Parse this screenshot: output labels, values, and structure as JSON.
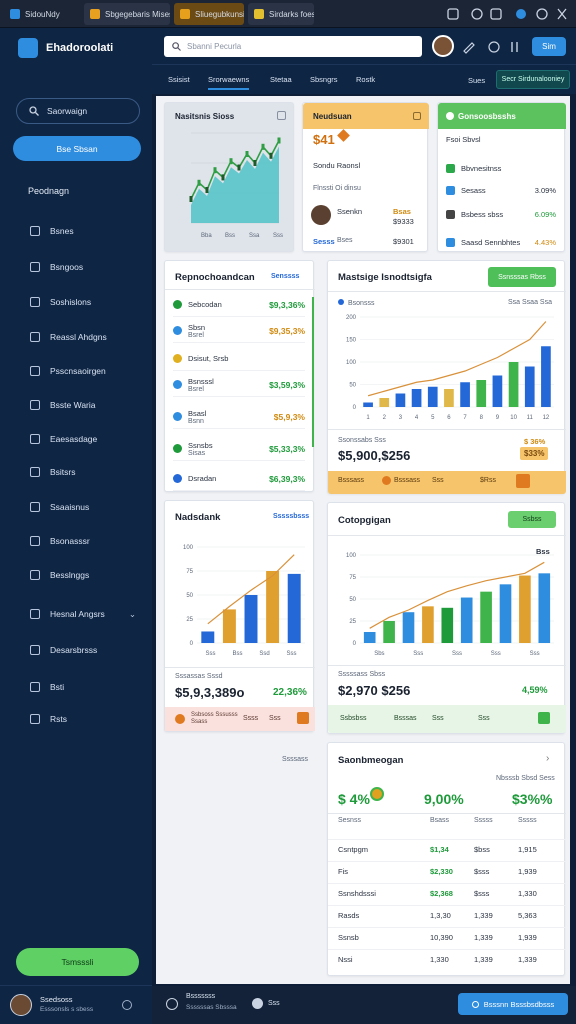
{
  "tabs": [
    {
      "label": "SidouNdy",
      "color": "#2f8de0"
    },
    {
      "label": "Sbgegebaris Mises",
      "color": "#e8a020"
    },
    {
      "label": "Sliuegubkunsi",
      "color": "#e6a01c"
    },
    {
      "label": "Sirdarks foes",
      "color": "#e2c030"
    }
  ],
  "app": {
    "title": "Ehadoroolati"
  },
  "search": {
    "placeholder": "Sbanni Pecurla"
  },
  "topbar": {
    "action_label": "Sim"
  },
  "subnav": {
    "items": [
      "Ssisist",
      "Srorwaewns",
      "Stetaa",
      "Sbsngrs",
      "Rostk"
    ],
    "right_link": "Sues",
    "right_button": "Secr Sirdunalooniey"
  },
  "sidebar": {
    "search_label": "Saorwaign",
    "primary_button": "Bse Sbsan",
    "section_label": "Peodnagn",
    "items": [
      {
        "label": "Bsnes",
        "icon": "book-icon"
      },
      {
        "label": "Bsngoos",
        "icon": "box-icon"
      },
      {
        "label": "Soshislons",
        "icon": "chain-icon"
      },
      {
        "label": "Reassl Ahdgns",
        "icon": "doc-icon"
      },
      {
        "label": "Psscnsaoirgen",
        "icon": "clock-icon"
      },
      {
        "label": "Bsste Waria",
        "icon": "globe-icon"
      },
      {
        "label": "Eaesasdage",
        "icon": "calendar-icon"
      },
      {
        "label": "Bsitsrs",
        "icon": "grid-icon"
      },
      {
        "label": "Ssaaisnus",
        "icon": "chart-icon"
      },
      {
        "label": "Bsonasssr",
        "icon": "layers-icon"
      },
      {
        "label": "Besslnggs",
        "icon": "pen-icon"
      },
      {
        "label": "Hesnal Angsrs",
        "icon": "cog-icon"
      },
      {
        "label": "Desarsbrsss",
        "icon": "filter-icon"
      },
      {
        "label": "Bsti",
        "icon": "gear-icon"
      },
      {
        "label": "Rsts",
        "icon": "refresh-icon"
      }
    ],
    "bottom_button": "Tsmsssli",
    "user_name": "Ssedsoss",
    "user_sub": "Esssonsls s sbess"
  },
  "card1": {
    "title": "Nasitsnis Sioss"
  },
  "card2": {
    "title": "Neudsuan",
    "value": "$41",
    "line1": "Sondu Raonsl",
    "line2": "Flnssti Oi dinsu",
    "rows": [
      {
        "name": "Ssenkn",
        "v1": "Bsas",
        "v2": "$9333"
      },
      {
        "name": "Sesss",
        "v1": "Bses",
        "v2": "$9301"
      }
    ]
  },
  "card3": {
    "title": "Gonsoosbsshs",
    "subtitle": "Fsoi Sbvsl",
    "rows": [
      {
        "name": "Bbvnesitnss",
        "val": "",
        "color": "#2aa84a"
      },
      {
        "name": "Sesass",
        "val": "3.09%",
        "color": "#2f8de0"
      },
      {
        "name": "Bsbess sbss",
        "val": "6.09%",
        "color": "#444444"
      },
      {
        "name": "Saasd Sennbhtes",
        "val": "4.43%",
        "color": "#2f8de0"
      }
    ]
  },
  "card4": {
    "title": "Repnochoandcan",
    "link": "Senssss",
    "rows": [
      {
        "name": "Sebcodan",
        "sub": "",
        "val": "$9,3,36%",
        "vcolor": "#1e9a3a",
        "icolor": "#1e9a3a"
      },
      {
        "name": "Sbsn",
        "sub": "Bsrel",
        "val": "$9,35,3%",
        "vcolor": "#d08a10",
        "icolor": "#2f8de0"
      },
      {
        "name": "Dsisut, Srsb",
        "sub": "",
        "val": "",
        "vcolor": "#1e9a3a",
        "icolor": "#e0b020"
      },
      {
        "name": "Bsnsssl",
        "sub": "Bsrel",
        "val": "$3,59,3%",
        "vcolor": "#1e9a3a",
        "icolor": "#2f8de0"
      },
      {
        "name": "Bsasl",
        "sub": "Bsnn",
        "val": "$5,9,3%",
        "vcolor": "#d08a10",
        "icolor": "#2f8de0"
      },
      {
        "name": "Ssnsbs",
        "sub": "Sisas",
        "val": "$5,33,3%",
        "vcolor": "#1e9a3a",
        "icolor": "#1e9a3a"
      },
      {
        "name": "Dsradan",
        "sub": "",
        "val": "$6,39,3%",
        "vcolor": "#1e9a3a",
        "icolor": "#2468d8"
      }
    ]
  },
  "card5": {
    "title": "Mastsige Isnodtsigfa",
    "button": "Ssnsssas Rbss",
    "legend": "Bsonsss",
    "legend_right": "Ssa  Ssaa  Ssa",
    "footer_label": "Ssonssabs Sss",
    "footer_value": "$5,900,$256",
    "footer_right1": "$ 36%",
    "footer_right2": "$33%",
    "strip": [
      "Bsssass",
      "Bsssass",
      "Sss",
      "$Rss"
    ]
  },
  "card6": {
    "title": "Nadsdank",
    "link": "Sssssbsss",
    "footer_label": "Sssassas Sssd",
    "value": "$5,9,3,389o",
    "right_value": "22,36%",
    "strip": [
      "Ssbsoss Sssusss Ssass",
      "Ssss",
      "Sss"
    ]
  },
  "card7": {
    "title": "Cotopgigan",
    "button": "Ssbss",
    "corner": "Bss",
    "footer_label": "Sssssass Sbss",
    "value": "$2,970 $256",
    "right_value": "4,59%",
    "strip": [
      "Ssbsbss",
      "Bsssas",
      "Sss",
      "Sss"
    ]
  },
  "card8": {
    "title": "Saonbmeogan",
    "sub": "Nbsssb Sbsd Sess",
    "stat1": "$ 4%",
    "stat2": "9,00%",
    "stat3": "$3%%",
    "headers": [
      "Sesnss",
      "Bsass",
      "Sssss",
      "Sssss"
    ],
    "rows": [
      [
        "Csntpgm",
        "$1,34",
        "$bss",
        "1,915"
      ],
      [
        "Fis",
        "$2,330",
        "$sss",
        "1,939"
      ],
      [
        "Ssnshdsssi",
        "$2,368",
        "$sss",
        "1,330"
      ],
      [
        "Rasds",
        "1,3,30",
        "1,339",
        "5,363"
      ],
      [
        "Ssnsb",
        "10,390",
        "1,339",
        "1,939"
      ],
      [
        "Nssi",
        "1,330",
        "1,339",
        "1,339"
      ]
    ]
  },
  "side_label": "Ssssass",
  "bottombar": {
    "label1": "Bsssssss",
    "label2": "Ssssssas Sbsssa",
    "mini": "Sss",
    "button": "Bsssnn Bsssbsdbsss"
  },
  "chart_data": [
    {
      "type": "area",
      "title": "Nasitsnis Sioss",
      "x": [
        "Bba",
        "Bss",
        "Ssa",
        "Sss"
      ],
      "series": [
        {
          "values": [
            20,
            38,
            30,
            52,
            44,
            62,
            55,
            70,
            60,
            78,
            68,
            85
          ]
        }
      ],
      "ylim": [
        0,
        100
      ]
    },
    {
      "type": "bar",
      "title": "Mastsige Isnodtsigfa",
      "categories": [
        "1",
        "2",
        "3",
        "4",
        "5",
        "6",
        "7",
        "8",
        "9",
        "10",
        "11",
        "12"
      ],
      "yticks": [
        "0",
        "50",
        "100",
        "150",
        "200"
      ],
      "series": [
        {
          "values": [
            10,
            20,
            30,
            40,
            45,
            40,
            55,
            60,
            70,
            100,
            90,
            135
          ]
        }
      ],
      "line": [
        25,
        35,
        45,
        55,
        60,
        70,
        80,
        95,
        110,
        130,
        150,
        190
      ],
      "ylim": [
        0,
        200
      ]
    },
    {
      "type": "bar",
      "title": "Nadsdank",
      "categories": [
        "Sss",
        "Bss",
        "Ssd",
        "Sss"
      ],
      "yticks": [
        "0",
        "25",
        "50",
        "75",
        "100"
      ],
      "series": [
        {
          "values": [
            12,
            35,
            50,
            75,
            72
          ]
        }
      ],
      "line": [
        20,
        38,
        55,
        70,
        92
      ],
      "ylim": [
        0,
        100
      ]
    },
    {
      "type": "bar",
      "title": "Cotopgigan",
      "categories": [
        "Sbs",
        "Sss",
        "Sss",
        "Sss",
        "Sss"
      ],
      "yticks": [
        "0",
        "25",
        "50",
        "75",
        "100"
      ],
      "series": [
        {
          "values": [
            15,
            30,
            42,
            50,
            48,
            62,
            70,
            80,
            92,
            95
          ]
        }
      ],
      "line": [
        20,
        35,
        45,
        58,
        70,
        78,
        85,
        90,
        95,
        110
      ],
      "ylim": [
        0,
        120
      ]
    }
  ]
}
